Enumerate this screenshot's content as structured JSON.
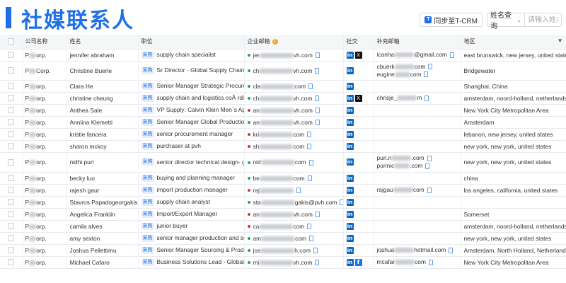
{
  "header": {
    "title": "社媒联系人",
    "sync_label": "同步至T-CRM",
    "search_select": "姓名查询",
    "search_placeholder": "请输入姓名"
  },
  "colors": {
    "accent": "#1e6fe8",
    "linkedin": "#0a66c2"
  },
  "columns": [
    "公司名称",
    "姓名",
    "职位",
    "企业邮箱",
    "社交",
    "补充邮箱",
    "地区"
  ],
  "position_tag": "采购",
  "rows": [
    {
      "company_a": "P",
      "company_b": "orp.",
      "name": "jennifer abraham",
      "title": "supply chain specialist",
      "email_a": "jer",
      "email_b": "vh.com",
      "dot": "#2ea44f",
      "social": [
        "in",
        "x"
      ],
      "extra": [
        {
          "a": "icanha",
          "b": "@gmail.com"
        }
      ],
      "region": "east brunswick, new jersey, united states",
      "h": 17
    },
    {
      "company_a": "P",
      "company_b": "Corp.",
      "name": "Christine Buerle",
      "title": "Sr Director - Global Supply Chain - St...",
      "email_a": "ch",
      "email_b": "vh.com",
      "dot": "#2ea44f",
      "social": [
        "in"
      ],
      "extra": [
        {
          "a": "cbuerk",
          "b": "com"
        },
        {
          "a": "eugine",
          "b": "com"
        }
      ],
      "region": "Bridgewater",
      "h": 27
    },
    {
      "company_a": "P",
      "company_b": "orp.",
      "name": "Clara He",
      "title": "Senior Manager Strategic Procurement",
      "email_a": "cla",
      "email_b": "com",
      "dot": "#2ea44f",
      "social": [
        "in"
      ],
      "extra": [],
      "region": "Shanghai, China",
      "h": 17
    },
    {
      "company_a": "P",
      "company_b": "orp.",
      "name": "christine cheung",
      "title": "supply chain and logistics coÂ rdinator",
      "email_a": "ch",
      "email_b": "vh.com",
      "dot": "#2ea44f",
      "social": [
        "in",
        "x"
      ],
      "extra": [
        {
          "a": "chrisje_",
          "b": "m"
        }
      ],
      "region": "amsterdam, noord-holland, netherlands",
      "h": 17
    },
    {
      "company_a": "P",
      "company_b": "orp.",
      "name": "Anthea Sale",
      "title": "VP Supply: Calvin Klein Men`s Appa...",
      "email_a": "an",
      "email_b": "vh.com",
      "dot": "#e03131",
      "social": [
        "in"
      ],
      "extra": [],
      "region": "New York City Metropolitan Area",
      "h": 17
    },
    {
      "company_a": "P",
      "company_b": "orp.",
      "name": "Anniina Klemetti",
      "title": "Senior Manager Global Production O...",
      "email_a": "an",
      "email_b": "vh.com",
      "dot": "#2ea44f",
      "social": [
        "in"
      ],
      "extra": [],
      "region": "Amsterdam",
      "h": 17
    },
    {
      "company_a": "P",
      "company_b": "orp.",
      "name": "kristie fancera",
      "title": "senior procurement manager",
      "email_a": "kri",
      "email_b": "com",
      "dot": "#e03131",
      "social": [
        "in"
      ],
      "extra": [],
      "region": "lebanon, new jersey, united states",
      "h": 17
    },
    {
      "company_a": "P",
      "company_b": "orp.",
      "name": "sharon mckoy",
      "title": "purchaser at pvh",
      "email_a": "sh",
      "email_b": "com",
      "dot": "#e03131",
      "social": [
        "in"
      ],
      "extra": [],
      "region": "new york, new york, united states",
      "h": 17
    },
    {
      "company_a": "P",
      "company_b": "orp.",
      "name": "nidhi puri",
      "title": "senior director technical design- glo...",
      "email_a": "nid",
      "email_b": "com",
      "dot": "#2ea44f",
      "social": [
        "in"
      ],
      "extra": [
        {
          "a": "puri.n",
          "b": ".com"
        },
        {
          "a": "purinic",
          "b": ".com"
        }
      ],
      "region": "new york, new york, united states",
      "h": 28
    },
    {
      "company_a": "P",
      "company_b": "orp.",
      "name": "becky luo",
      "title": "buying and planning manager",
      "email_a": "be",
      "email_b": "com",
      "dot": "#2ea44f",
      "social": [
        "in"
      ],
      "extra": [],
      "region": "china",
      "h": 17
    },
    {
      "company_a": "P",
      "company_b": "orp.",
      "name": "rajesh gaur",
      "title": "import production manager",
      "email_a": "raj",
      "email_b": "",
      "dot": "#e03131",
      "social": [
        "in"
      ],
      "extra": [
        {
          "a": "rajgau",
          "b": "com"
        }
      ],
      "region": "los angeles, california, united states",
      "h": 17
    },
    {
      "company_a": "P",
      "company_b": "orp.",
      "name": "Stavros Papadogeorgakis",
      "title": "supply chain analyst",
      "email_a": "sta",
      "email_b": "gakis@pvh.com",
      "dot": "#2ea44f",
      "social": [
        "in"
      ],
      "extra": [],
      "region": "",
      "h": 17
    },
    {
      "company_a": "P",
      "company_b": "orp.",
      "name": "Angelica Franklin",
      "title": "Import/Export Manager",
      "email_a": "an",
      "email_b": "vh.com",
      "dot": "#e03131",
      "social": [
        "in"
      ],
      "extra": [],
      "region": "Somerset",
      "h": 17
    },
    {
      "company_a": "P",
      "company_b": "orp.",
      "name": "camila alves",
      "title": "junior buyer",
      "email_a": "ca",
      "email_b": "com",
      "dot": "#e03131",
      "social": [
        "in"
      ],
      "extra": [],
      "region": "amsterdam, noord-holland, netherlands",
      "h": 17
    },
    {
      "company_a": "P",
      "company_b": "orp.",
      "name": "amy sexton",
      "title": "senior manager production and sour...",
      "email_a": "am",
      "email_b": "com",
      "dot": "#2ea44f",
      "social": [
        "in"
      ],
      "extra": [],
      "region": "new york, new york, united states",
      "h": 17
    },
    {
      "company_a": "P",
      "company_b": "orp.",
      "name": "Joshua Pellettimu",
      "title": "Senior Manager Sourcing & Producti...",
      "email_a": "jos",
      "email_b": "h.com",
      "dot": "#2ea44f",
      "social": [
        "in"
      ],
      "extra": [
        {
          "a": "joshua",
          "b": "hotmail.com"
        }
      ],
      "region": "Amsterdam, North Holland, Netherlands",
      "h": 17
    },
    {
      "company_a": "P",
      "company_b": "orp.",
      "name": "Michael Cafaro",
      "title": "Business Solutions Lead - Global Om...",
      "email_a": "mi",
      "email_b": "vh.com",
      "dot": "#2ea44f",
      "social": [
        "in",
        "fb"
      ],
      "extra": [
        {
          "a": "mcafar",
          "b": "com"
        }
      ],
      "region": "New York City Metropolitan Area",
      "h": 17
    }
  ]
}
